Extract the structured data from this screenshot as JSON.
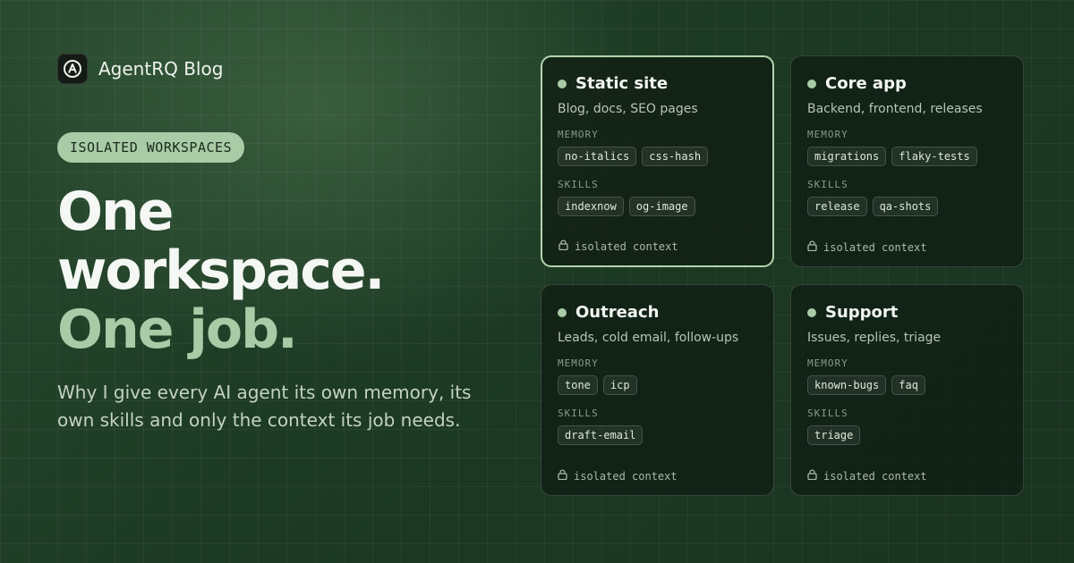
{
  "brand": {
    "name": "AgentRQ Blog",
    "logo_letter": "A"
  },
  "badge": "ISOLATED WORKSPACES",
  "headline": {
    "line1": "One workspace.",
    "line2": "One job."
  },
  "subtitle": "Why I give every AI agent its own memory, its own skills and only the context its job needs.",
  "colors": {
    "accent": "#a9cba6",
    "background": "#1f3a25"
  },
  "labels": {
    "memory": "MEMORY",
    "skills": "SKILLS",
    "footer": "isolated context"
  },
  "cards": [
    {
      "title": "Static site",
      "desc": "Blog, docs, SEO pages",
      "memory": [
        "no-italics",
        "css-hash"
      ],
      "skills": [
        "indexnow",
        "og-image"
      ],
      "active": true
    },
    {
      "title": "Core app",
      "desc": "Backend, frontend, releases",
      "memory": [
        "migrations",
        "flaky-tests"
      ],
      "skills": [
        "release",
        "qa-shots"
      ],
      "active": false
    },
    {
      "title": "Outreach",
      "desc": "Leads, cold email, follow-ups",
      "memory": [
        "tone",
        "icp"
      ],
      "skills": [
        "draft-email"
      ],
      "active": false
    },
    {
      "title": "Support",
      "desc": "Issues, replies, triage",
      "memory": [
        "known-bugs",
        "faq"
      ],
      "skills": [
        "triage"
      ],
      "active": false
    }
  ]
}
